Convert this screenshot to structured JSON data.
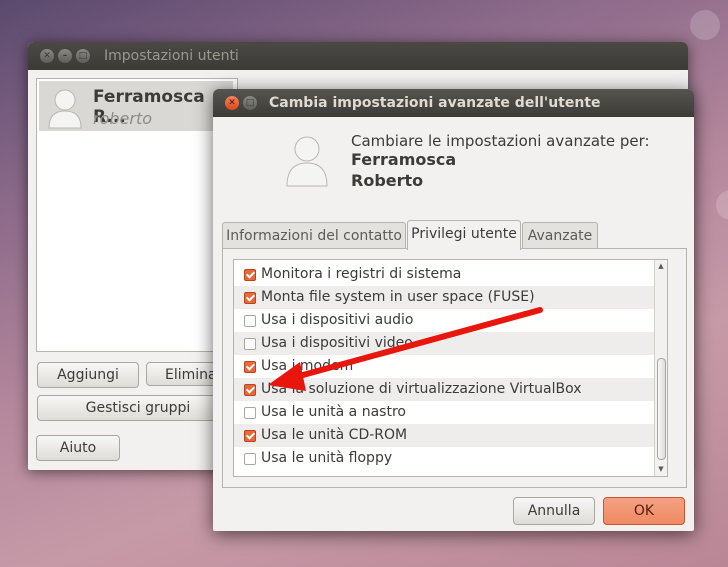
{
  "back_window": {
    "title": "Impostazioni utenti",
    "user": {
      "name": "Ferramosca R...",
      "login": "roberto"
    },
    "buttons": {
      "add": "Aggiungi",
      "delete": "Elimina",
      "manage_groups": "Gestisci gruppi",
      "help": "Aiuto"
    }
  },
  "dialog": {
    "title": "Cambia impostazioni avanzate dell'utente",
    "header_text": "Cambiare le impostazioni avanzate per:",
    "user_first": "Ferramosca",
    "user_second": "Roberto",
    "tabs": [
      {
        "label": "Informazioni del contatto",
        "active": false
      },
      {
        "label": "Privilegi utente",
        "active": true
      },
      {
        "label": "Avanzate",
        "active": false
      }
    ],
    "privileges": [
      {
        "label": "Monitora i registri di sistema",
        "checked": true
      },
      {
        "label": "Monta file system in user space (FUSE)",
        "checked": true
      },
      {
        "label": "Usa i dispositivi audio",
        "checked": false
      },
      {
        "label": "Usa i dispositivi video",
        "checked": false
      },
      {
        "label": "Usa i modem",
        "checked": true
      },
      {
        "label": "Usa la soluzione di virtualizzazione VirtualBox",
        "checked": true
      },
      {
        "label": "Usa le unità a nastro",
        "checked": false
      },
      {
        "label": "Usa le unità CD-ROM",
        "checked": true
      },
      {
        "label": "Usa le unità floppy",
        "checked": false
      }
    ],
    "buttons": {
      "cancel": "Annulla",
      "ok": "OK"
    }
  },
  "colors": {
    "accent": "#e8683b",
    "annotation_arrow": "#e8160c"
  }
}
